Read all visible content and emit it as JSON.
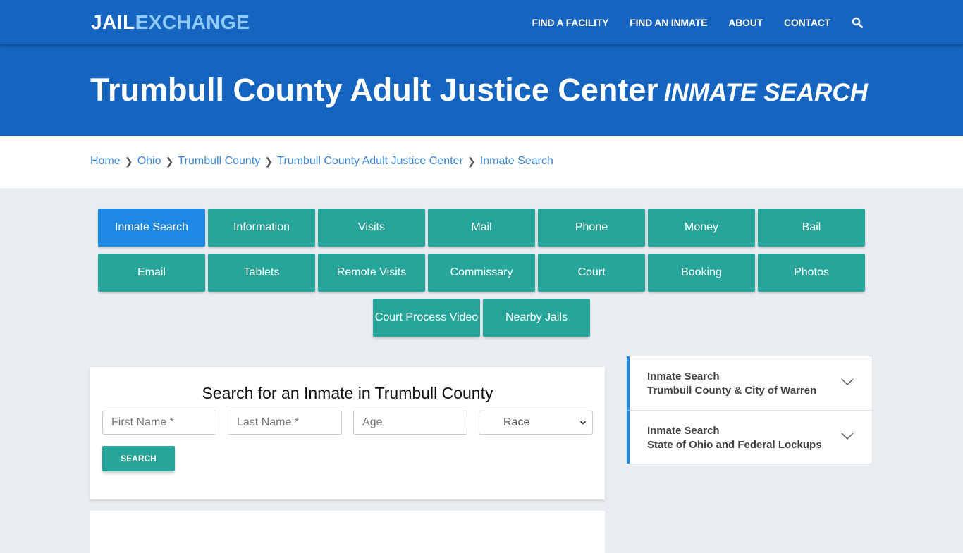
{
  "header": {
    "logo_part1": "JAIL",
    "logo_part2": "EXCHANGE",
    "nav": [
      "FIND A FACILITY",
      "FIND AN INMATE",
      "ABOUT",
      "CONTACT"
    ],
    "search_icon": "search-icon"
  },
  "hero": {
    "title": "Trumbull County Adult Justice Center",
    "subtitle": "INMATE SEARCH"
  },
  "breadcrumb": [
    "Home",
    "Ohio",
    "Trumbull County",
    "Trumbull County Adult Justice Center",
    "Inmate Search"
  ],
  "tabs": {
    "active": "Inmate Search",
    "items": [
      "Inmate Search",
      "Information",
      "Visits",
      "Mail",
      "Phone",
      "Money",
      "Bail",
      "Email",
      "Tablets",
      "Remote Visits",
      "Commissary",
      "Court",
      "Booking",
      "Photos",
      "Court Process Video",
      "Nearby Jails"
    ]
  },
  "search_form": {
    "title": "Search for an Inmate in Trumbull County",
    "first_name_placeholder": "First Name *",
    "last_name_placeholder": "Last Name *",
    "age_placeholder": "Age",
    "race_selected": "Race",
    "button": "SEARCH"
  },
  "sidebar": {
    "items": [
      {
        "line1": "Inmate Search",
        "line2": "Trumbull County & City of Warren"
      },
      {
        "line1": "Inmate Search",
        "line2": "State of Ohio and Federal Lockups"
      }
    ]
  },
  "colors": {
    "brand_blue": "#1565c0",
    "logo_accent": "#90caf9",
    "tab_teal": "#26a69a",
    "tab_active": "#1e88e5",
    "link": "#3a86d4"
  }
}
